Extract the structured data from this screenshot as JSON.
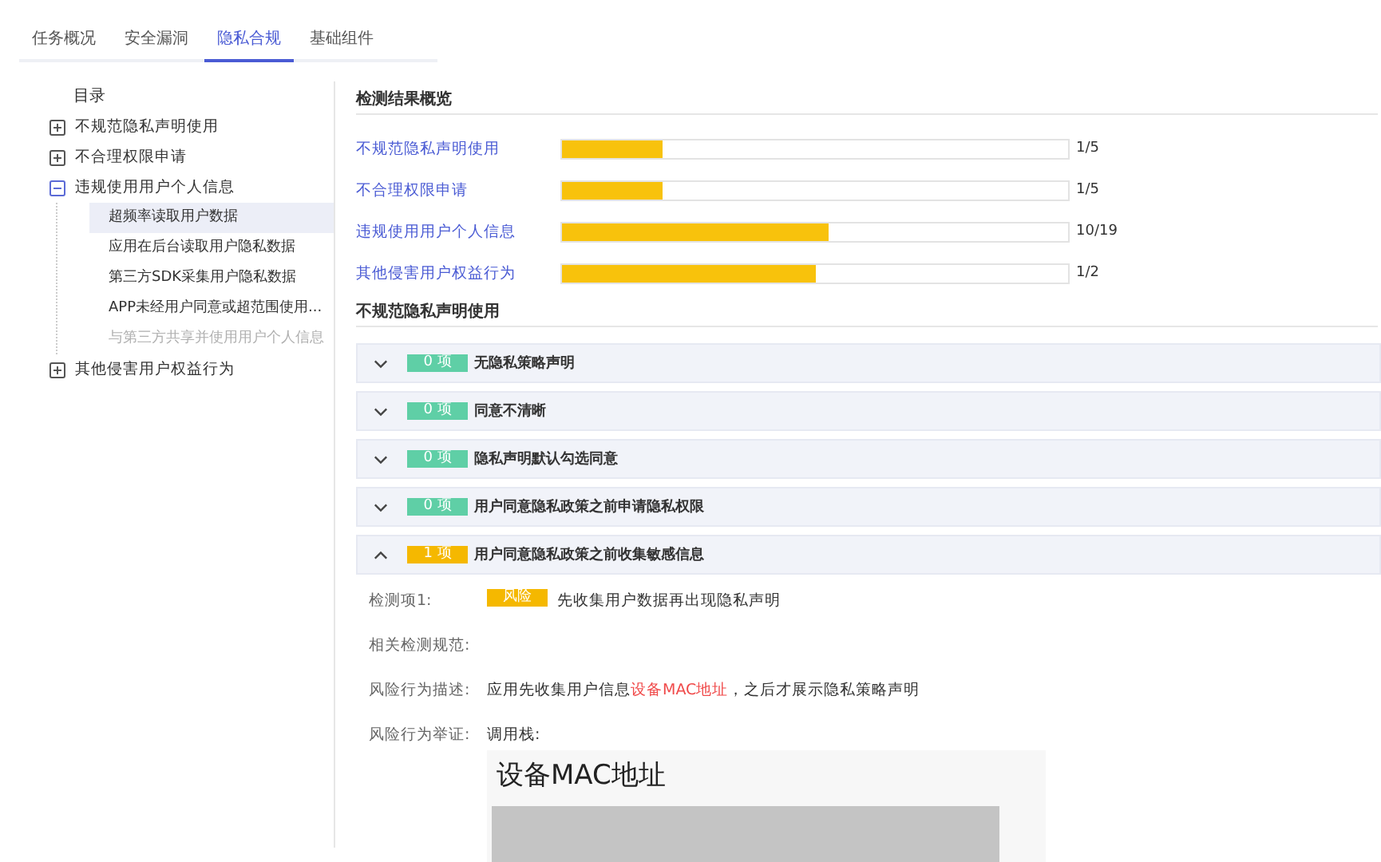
{
  "tabs": [
    {
      "label": "任务概况",
      "selected": false
    },
    {
      "label": "安全漏洞",
      "selected": false
    },
    {
      "label": "隐私合规",
      "selected": true
    },
    {
      "label": "基础组件",
      "selected": false
    }
  ],
  "sidebar": {
    "title": "目录",
    "items": [
      {
        "label": "不规范隐私声明使用",
        "expanded": false
      },
      {
        "label": "不合理权限申请",
        "expanded": false
      },
      {
        "label": "违规使用用户个人信息",
        "expanded": true,
        "children": [
          {
            "label": "超频率读取用户数据",
            "selected": true,
            "disabled": false
          },
          {
            "label": "应用在后台读取用户隐私数据",
            "selected": false,
            "disabled": false
          },
          {
            "label": "第三方SDK采集用户隐私数据",
            "selected": false,
            "disabled": false
          },
          {
            "label": "APP未经用户同意或超范围使用...",
            "selected": false,
            "disabled": false
          },
          {
            "label": "与第三方共享并使用用户个人信息",
            "selected": false,
            "disabled": true
          }
        ]
      },
      {
        "label": "其他侵害用户权益行为",
        "expanded": false
      }
    ]
  },
  "overview": {
    "title": "检测结果概览",
    "rows": [
      {
        "label": "不规范隐私声明使用",
        "level": 0.2,
        "reading": "1/5"
      },
      {
        "label": "不合理权限申请",
        "level": 0.2,
        "reading": "1/5"
      },
      {
        "label": "违规使用用户个人信息",
        "level": 0.526,
        "reading": "10/19"
      },
      {
        "label": "其他侵害用户权益行为",
        "level": 0.5,
        "reading": "1/2"
      }
    ]
  },
  "section": {
    "title": "不规范隐私声明使用",
    "panels": [
      {
        "badge": "0 项",
        "color": "#5fcfa6",
        "title": "无隐私策略声明",
        "expanded": false
      },
      {
        "badge": "0 项",
        "color": "#5fcfa6",
        "title": "同意不清晰",
        "expanded": false
      },
      {
        "badge": "0 项",
        "color": "#5fcfa6",
        "title": "隐私声明默认勾选同意",
        "expanded": false
      },
      {
        "badge": "0 项",
        "color": "#5fcfa6",
        "title": "用户同意隐私政策之前申请隐私权限",
        "expanded": false
      },
      {
        "badge": "1 项",
        "color": "#f5b800",
        "title": "用户同意隐私政策之前收集敏感信息",
        "expanded": true
      }
    ]
  },
  "detail": {
    "check_label": "检测项1:",
    "risk_tag": "风险",
    "check_text": "先收集用户数据再出现隐私声明",
    "spec_label": "相关检测规范:",
    "desc_label": "风险行为描述:",
    "desc": [
      {
        "text": "应用先收集用户信息",
        "highlight": false
      },
      {
        "text": "设备MAC地址",
        "highlight": true
      },
      {
        "text": "，之后才展示隐私策略声明",
        "highlight": false
      }
    ],
    "evidence_label": "风险行为举证:",
    "stack_label": "调用栈:",
    "stack_title": "设备MAC地址"
  }
}
